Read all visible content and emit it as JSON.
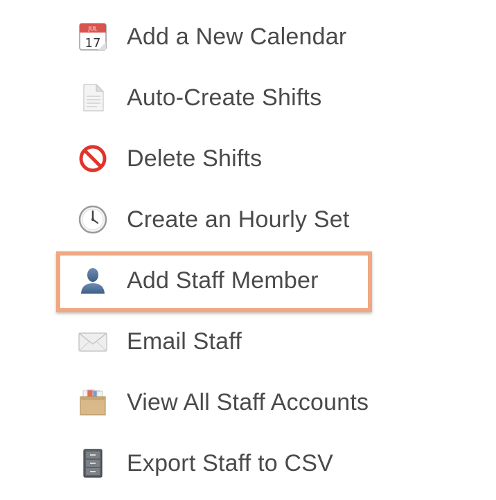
{
  "menu": {
    "items": [
      {
        "label": "Add a New Calendar",
        "icon": "calendar-icon",
        "icon_text_month": "JUL",
        "icon_text_day": "17"
      },
      {
        "label": "Auto-Create Shifts",
        "icon": "document-icon"
      },
      {
        "label": "Delete Shifts",
        "icon": "prohibited-icon"
      },
      {
        "label": "Create an Hourly Set",
        "icon": "clock-icon"
      },
      {
        "label": "Add Staff Member",
        "icon": "user-silhouette-icon",
        "highlighted": true
      },
      {
        "label": "Email Staff",
        "icon": "envelope-icon"
      },
      {
        "label": "View All Staff Accounts",
        "icon": "card-file-box-icon"
      },
      {
        "label": "Export Staff to CSV",
        "icon": "file-cabinet-icon"
      }
    ]
  },
  "colors": {
    "text": "#4a4a4a",
    "highlight": "#f0a882"
  }
}
